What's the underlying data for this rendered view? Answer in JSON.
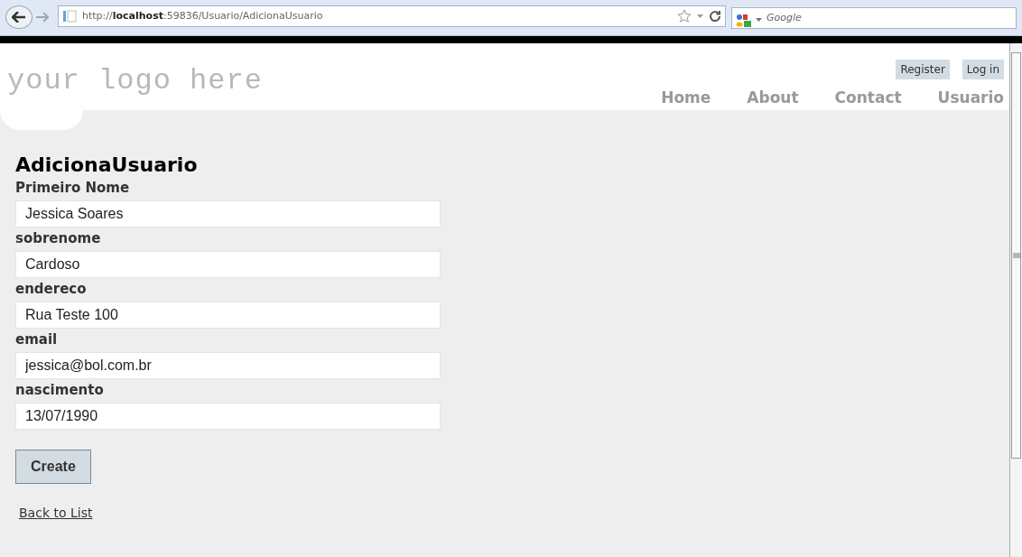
{
  "browser": {
    "address": "http://**localhost**:59836/Usuario/AdicionaUsuario",
    "search": {
      "placeholder": "Google"
    }
  },
  "header": {
    "logo": "your logo here",
    "account_links": [
      "Register",
      "Log in"
    ],
    "nav": [
      "Home",
      "About",
      "Contact",
      "Usuario"
    ]
  },
  "page": {
    "title": "AdicionaUsuario",
    "fields": [
      {
        "label": "Primeiro Nome",
        "value": "Jessica Soares"
      },
      {
        "label": "sobrenome",
        "value": "Cardoso"
      },
      {
        "label": "endereco",
        "value": "Rua Teste 100"
      },
      {
        "label": "email",
        "value": "jessica@bol.com.br"
      },
      {
        "label": "nascimento",
        "value": "13/07/1990"
      }
    ],
    "submit": "Create",
    "back_link": "Back to List"
  }
}
